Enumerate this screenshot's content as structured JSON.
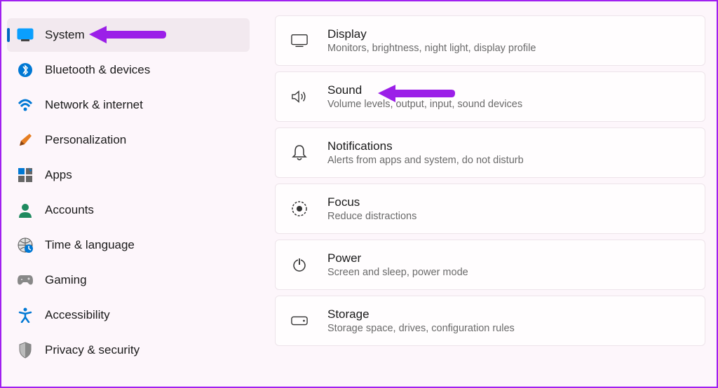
{
  "sidebar": {
    "items": [
      {
        "label": "System",
        "active": true
      },
      {
        "label": "Bluetooth & devices",
        "active": false
      },
      {
        "label": "Network & internet",
        "active": false
      },
      {
        "label": "Personalization",
        "active": false
      },
      {
        "label": "Apps",
        "active": false
      },
      {
        "label": "Accounts",
        "active": false
      },
      {
        "label": "Time & language",
        "active": false
      },
      {
        "label": "Gaming",
        "active": false
      },
      {
        "label": "Accessibility",
        "active": false
      },
      {
        "label": "Privacy & security",
        "active": false
      }
    ]
  },
  "main": {
    "cards": [
      {
        "title": "Display",
        "desc": "Monitors, brightness, night light, display profile"
      },
      {
        "title": "Sound",
        "desc": "Volume levels, output, input, sound devices"
      },
      {
        "title": "Notifications",
        "desc": "Alerts from apps and system, do not disturb"
      },
      {
        "title": "Focus",
        "desc": "Reduce distractions"
      },
      {
        "title": "Power",
        "desc": "Screen and sleep, power mode"
      },
      {
        "title": "Storage",
        "desc": "Storage space, drives, configuration rules"
      }
    ]
  },
  "annotations": {
    "arrow_color": "#9b1fe8"
  }
}
